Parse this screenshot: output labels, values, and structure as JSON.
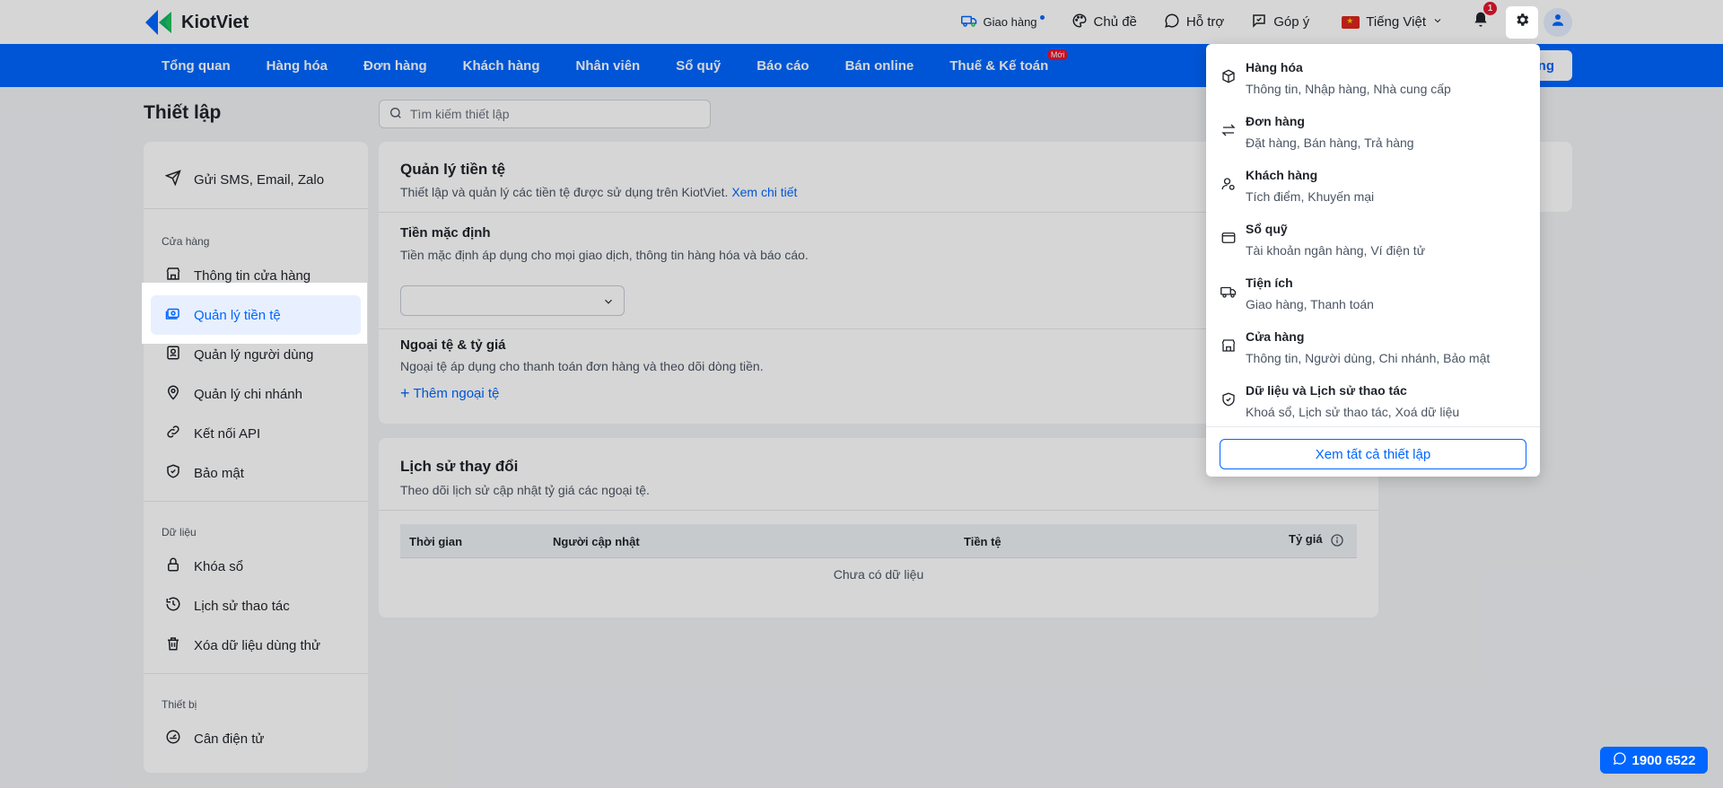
{
  "brand": {
    "name": "KiotViet"
  },
  "topbar": {
    "delivery": "Giao hàng",
    "theme": "Chủ đề",
    "support": "Hỗ trợ",
    "feedback": "Góp ý",
    "language": "Tiếng Việt",
    "notifications_count": "1"
  },
  "nav": {
    "items": [
      "Tổng quan",
      "Hàng hóa",
      "Đơn hàng",
      "Khách hàng",
      "Nhân viên",
      "Sổ quỹ",
      "Báo cáo",
      "Bán online",
      "Thuế & Kế toán"
    ],
    "new_badge": "Mới",
    "cta": "ng"
  },
  "page": {
    "title": "Thiết lập",
    "search_placeholder": "Tìm kiếm thiết lập"
  },
  "sidebar": {
    "top_item": "Gửi SMS, Email, Zalo",
    "sections": [
      {
        "heading": "Cửa hàng",
        "items": [
          "Thông tin cửa hàng",
          "Quản lý tiền tệ",
          "Quản lý người dùng",
          "Quản lý chi nhánh",
          "Kết nối API",
          "Bảo mật"
        ]
      },
      {
        "heading": "Dữ liệu",
        "items": [
          "Khóa sổ",
          "Lịch sử thao tác",
          "Xóa dữ liệu dùng thử"
        ]
      },
      {
        "heading": "Thiết bị",
        "items": [
          "Cân điện tử"
        ]
      }
    ],
    "active": "Quản lý tiền tệ"
  },
  "currency_card": {
    "title": "Quản lý tiền tệ",
    "desc": "Thiết lập và quản lý các tiền tệ được sử dụng trên KiotViet.",
    "desc_link": "Xem chi tiết",
    "default_title": "Tiền mặc định",
    "default_desc": "Tiền mặc định áp dụng cho mọi giao dịch, thông tin hàng hóa và báo cáo.",
    "select_value": "",
    "foreign_title": "Ngoại tệ & tỷ giá",
    "foreign_desc": "Ngoại tệ áp dụng cho thanh toán đơn hàng và theo dõi dòng tiền.",
    "add_foreign": "Thêm ngoại tệ"
  },
  "history_card": {
    "title": "Lịch sử thay đổi",
    "desc": "Theo dõi lịch sử cập nhật tỷ giá các ngoại tệ.",
    "columns": [
      "Thời gian",
      "Người cập nhật",
      "Tiền tệ",
      "Tỷ giá"
    ],
    "empty": "Chưa có dữ liệu"
  },
  "settings_menu": {
    "items": [
      {
        "title": "Hàng hóa",
        "sub": "Thông tin, Nhập hàng, Nhà cung cấp",
        "icon": "box-icon"
      },
      {
        "title": "Đơn hàng",
        "sub": "Đặt hàng, Bán hàng, Trả hàng",
        "icon": "swap-icon"
      },
      {
        "title": "Khách hàng",
        "sub": "Tích điểm, Khuyến mại",
        "icon": "user-settings-icon"
      },
      {
        "title": "Sổ quỹ",
        "sub": "Tài khoản ngân hàng, Ví điện tử",
        "icon": "wallet-icon"
      },
      {
        "title": "Tiện ích",
        "sub": "Giao hàng, Thanh toán",
        "icon": "truck-icon"
      },
      {
        "title": "Cửa hàng",
        "sub": "Thông tin, Người dùng, Chi nhánh, Bảo mật",
        "icon": "store-icon"
      },
      {
        "title": "Dữ liệu và Lịch sử thao tác",
        "sub": "Khoá sổ, Lịch sử thao tác, Xoá dữ liệu",
        "icon": "shield-check-icon"
      }
    ],
    "footer": "Xem tất cả thiết lập"
  },
  "hotline": "1900 6522"
}
